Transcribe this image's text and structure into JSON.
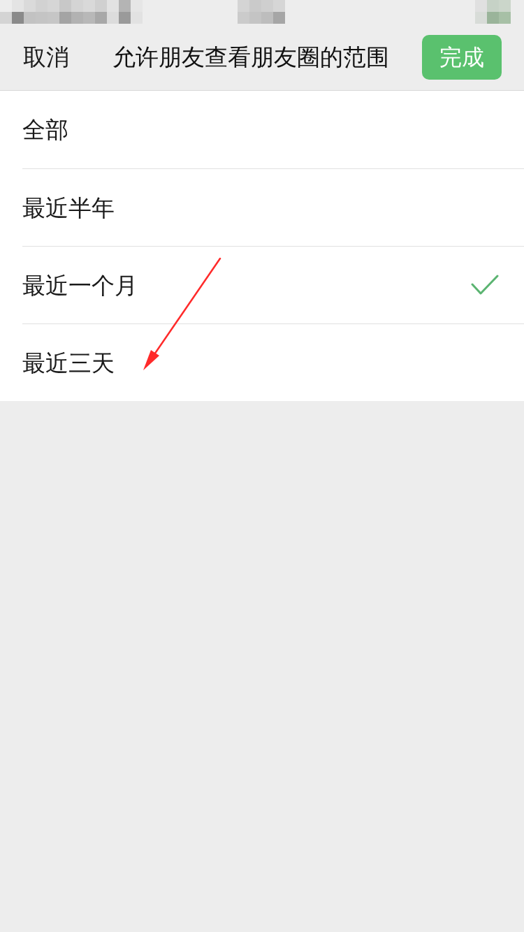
{
  "nav_bar": {
    "cancel": "取消",
    "title": "允许朋友查看朋友圈的范围",
    "done": "完成"
  },
  "options": [
    {
      "label": "全部",
      "selected": false
    },
    {
      "label": "最近半年",
      "selected": false
    },
    {
      "label": "最近一个月",
      "selected": true
    },
    {
      "label": "最近三天",
      "selected": false
    }
  ]
}
